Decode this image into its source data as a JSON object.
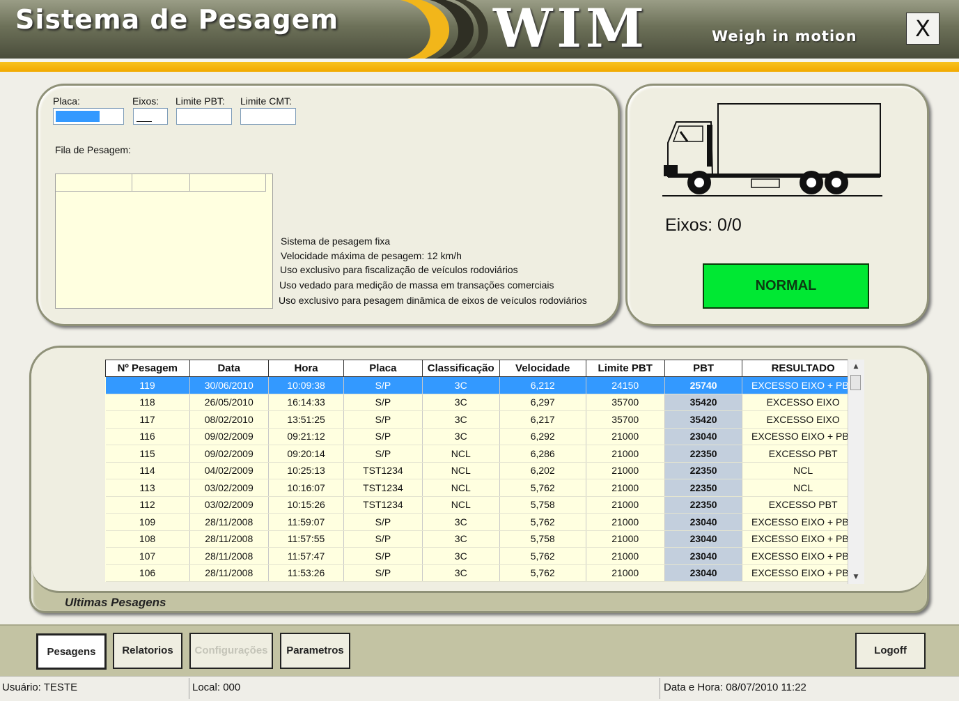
{
  "header": {
    "title": "Sistema de Pesagem",
    "logo": "WIM",
    "subtitle": "Weigh in motion",
    "close_label": "X"
  },
  "form": {
    "placa_label": "Placa:",
    "eixos_label": "Eixos:",
    "limite_pbt_label": "Limite PBT:",
    "limite_cmt_label": "Limite CMT:",
    "placa_value": "",
    "eixos_value": "",
    "limite_pbt_value": "",
    "limite_cmt_value": "",
    "fila_label": "Fila de Pesagem:"
  },
  "info_lines": [
    "Sistema de pesagem fixa",
    "Velocidade máxima de pesagem: 12 km/h",
    "Uso exclusivo para fiscalização de veículos rodoviários",
    "Uso vedado para medição de massa em transações comerciais",
    "Uso exclusivo para pesagem dinâmica de eixos de veículos rodoviários"
  ],
  "truck_panel": {
    "eixos_text": "Eixos: 0/0",
    "status": "NORMAL",
    "status_color": "#00e833",
    "icon": "truck-icon"
  },
  "table": {
    "caption": "Ultimas Pesagens",
    "columns": [
      "Nº Pesagem",
      "Data",
      "Hora",
      "Placa",
      "Classificação",
      "Velocidade",
      "Limite PBT",
      "PBT",
      "RESULTADO"
    ],
    "selected_row": 0,
    "rows": [
      [
        "119",
        "30/06/2010",
        "10:09:38",
        "S/P",
        "3C",
        "6,212",
        "24150",
        "25740",
        "EXCESSO EIXO + PBT"
      ],
      [
        "118",
        "26/05/2010",
        "16:14:33",
        "S/P",
        "3C",
        "6,297",
        "35700",
        "35420",
        "EXCESSO EIXO"
      ],
      [
        "117",
        "08/02/2010",
        "13:51:25",
        "S/P",
        "3C",
        "6,217",
        "35700",
        "35420",
        "EXCESSO EIXO"
      ],
      [
        "116",
        "09/02/2009",
        "09:21:12",
        "S/P",
        "3C",
        "6,292",
        "21000",
        "23040",
        "EXCESSO EIXO + PBT"
      ],
      [
        "115",
        "09/02/2009",
        "09:20:14",
        "S/P",
        "NCL",
        "6,286",
        "21000",
        "22350",
        "EXCESSO PBT"
      ],
      [
        "114",
        "04/02/2009",
        "10:25:13",
        "TST1234",
        "NCL",
        "6,202",
        "21000",
        "22350",
        "NCL"
      ],
      [
        "113",
        "03/02/2009",
        "10:16:07",
        "TST1234",
        "NCL",
        "5,762",
        "21000",
        "22350",
        "NCL"
      ],
      [
        "112",
        "03/02/2009",
        "10:15:26",
        "TST1234",
        "NCL",
        "5,758",
        "21000",
        "22350",
        "EXCESSO PBT"
      ],
      [
        "109",
        "28/11/2008",
        "11:59:07",
        "S/P",
        "3C",
        "5,762",
        "21000",
        "23040",
        "EXCESSO EIXO + PBT"
      ],
      [
        "108",
        "28/11/2008",
        "11:57:55",
        "S/P",
        "3C",
        "5,758",
        "21000",
        "23040",
        "EXCESSO EIXO + PBT"
      ],
      [
        "107",
        "28/11/2008",
        "11:57:47",
        "S/P",
        "3C",
        "5,762",
        "21000",
        "23040",
        "EXCESSO EIXO + PBT"
      ],
      [
        "106",
        "28/11/2008",
        "11:53:26",
        "S/P",
        "3C",
        "5,762",
        "21000",
        "23040",
        "EXCESSO EIXO + PBT"
      ]
    ]
  },
  "nav": {
    "pesagens": "Pesagens",
    "relatorios": "Relatorios",
    "configuracoes": "Configurações",
    "parametros": "Parametros",
    "logoff": "Logoff"
  },
  "statusbar": {
    "usuario": "Usuário: TESTE",
    "local": "Local: 000",
    "datahora": "Data e Hora:  08/07/2010  11:22"
  },
  "colors": {
    "accent_yellow": "#f2a900",
    "header_olive": "#6d7159",
    "selection_blue": "#3399ff"
  }
}
